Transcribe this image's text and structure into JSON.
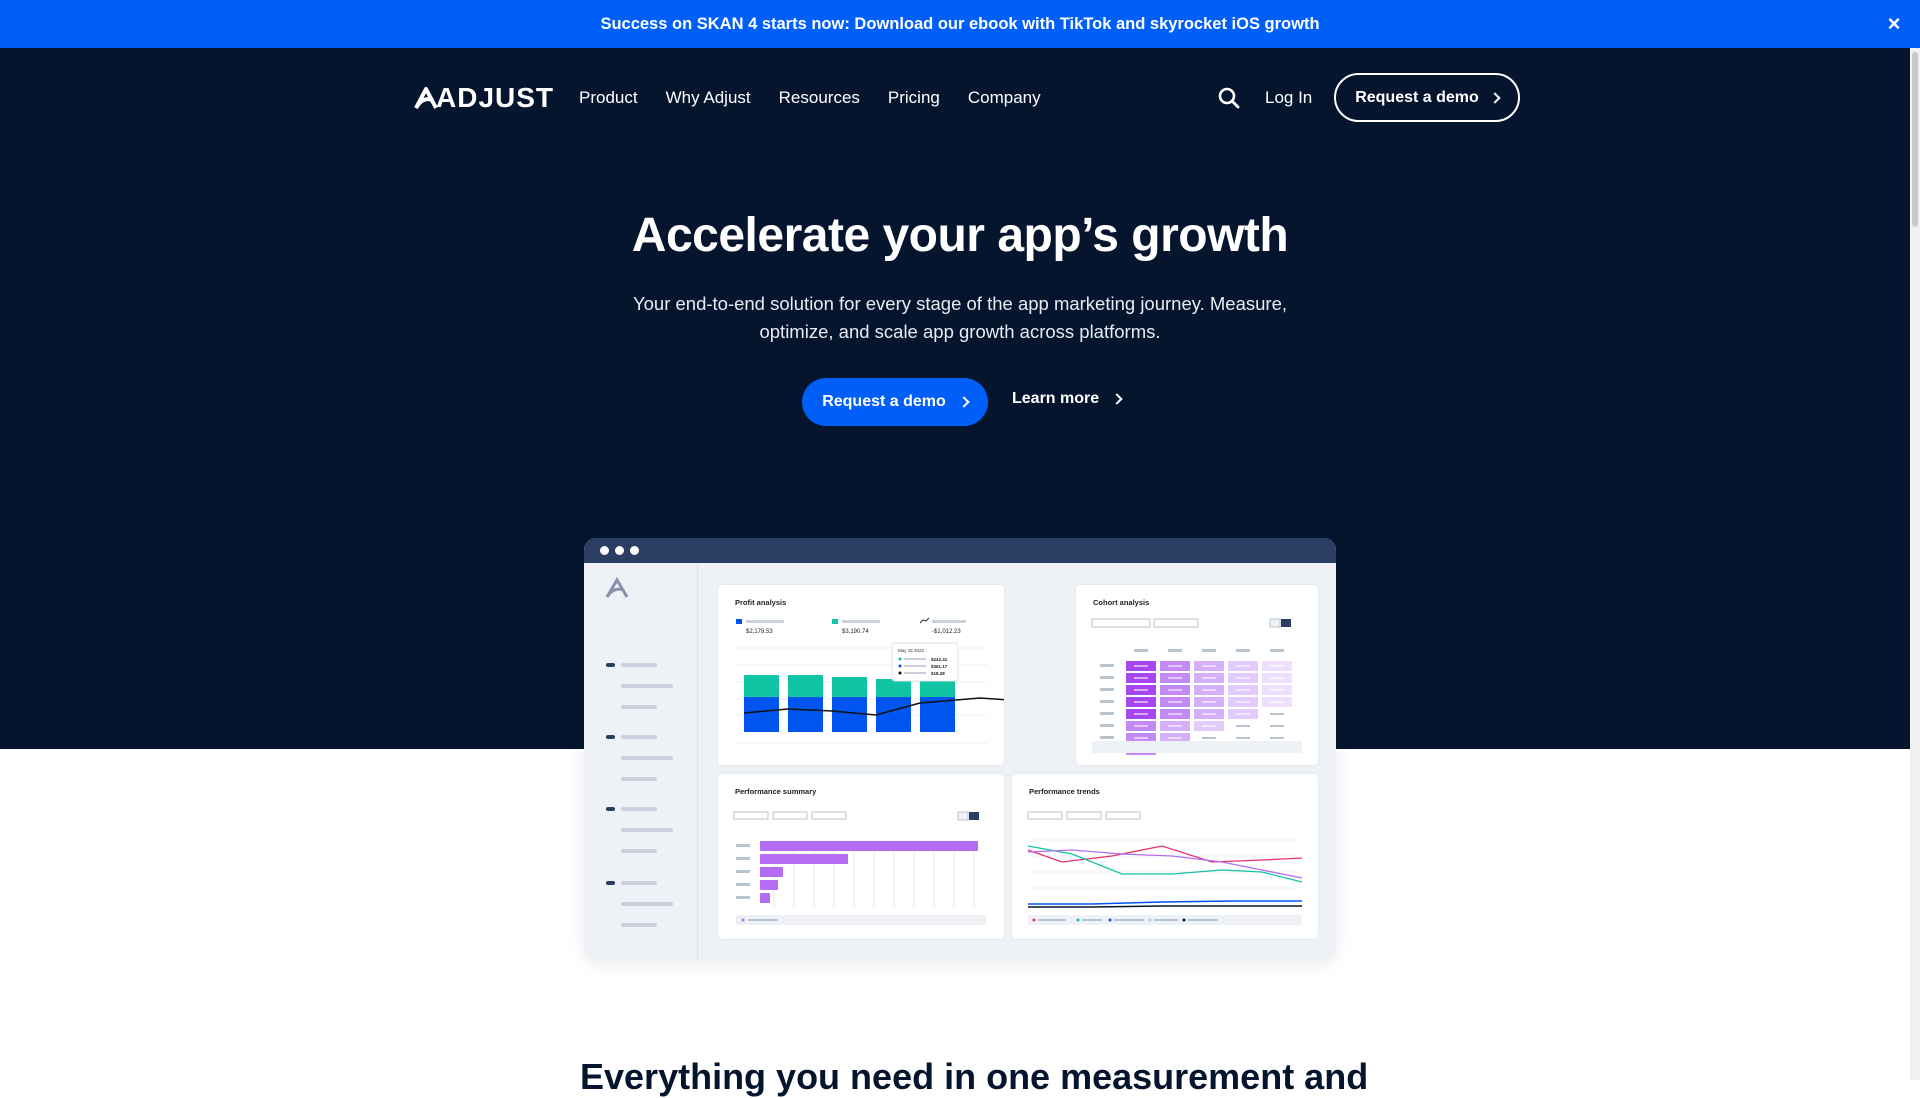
{
  "banner": {
    "text": "Success on SKAN 4 starts now: Download our ebook with TikTok and skyrocket iOS growth",
    "close": "×"
  },
  "logo": {
    "text": "ADJUST"
  },
  "nav": {
    "items": [
      "Product",
      "Why Adjust",
      "Resources",
      "Pricing",
      "Company"
    ]
  },
  "header": {
    "login": "Log In",
    "demo": "Request a demo"
  },
  "hero": {
    "title": "Accelerate your app’s growth",
    "subtitle": "Your end-to-end solution for every stage of the app marketing journey. Measure, optimize, and scale app growth across platforms.",
    "demo": "Request a demo",
    "learn": "Learn more"
  },
  "dashboard": {
    "profit": {
      "title": "Profit analysis",
      "stats": [
        "$2,178.53",
        "$3,190.74",
        "-$1,012.23"
      ],
      "tooltip": {
        "date": "May 15 2022",
        "values": [
          "$242.41",
          "$361.17",
          "$18.28"
        ]
      }
    },
    "cohort": {
      "title": "Cohort analysis"
    },
    "summary": {
      "title": "Performance summary"
    },
    "trends": {
      "title": "Performance trends"
    }
  },
  "section": {
    "heading": "Everything you need in one measurement and"
  },
  "colors": {
    "banner": "#005ff9",
    "hero_bg": "#05152d",
    "teal": "#10c4a4",
    "blue": "#0055f0",
    "purple": "#b46cf5"
  }
}
